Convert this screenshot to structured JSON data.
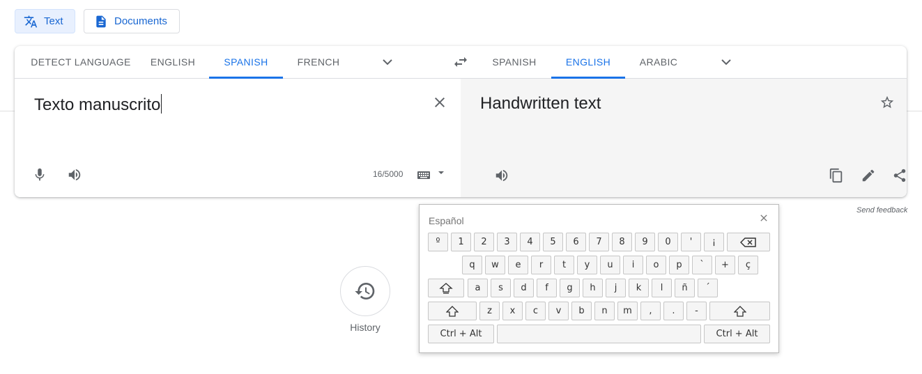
{
  "modes": {
    "text_label": "Text",
    "documents_label": "Documents"
  },
  "source_langs": [
    "DETECT LANGUAGE",
    "ENGLISH",
    "SPANISH",
    "FRENCH"
  ],
  "target_langs": [
    "SPANISH",
    "ENGLISH",
    "ARABIC"
  ],
  "source": {
    "text": "Texto manuscrito",
    "char_count": "16/5000"
  },
  "target": {
    "text": "Handwritten text"
  },
  "feedback_label": "Send feedback",
  "history_label": "History",
  "keyboard": {
    "title": "Español",
    "row1": [
      "º",
      "1",
      "2",
      "3",
      "4",
      "5",
      "6",
      "7",
      "8",
      "9",
      "0",
      "'",
      "¡"
    ],
    "row2": [
      "q",
      "w",
      "e",
      "r",
      "t",
      "y",
      "u",
      "i",
      "o",
      "p",
      "`",
      "+",
      "ç"
    ],
    "row3": [
      "a",
      "s",
      "d",
      "f",
      "g",
      "h",
      "j",
      "k",
      "l",
      "ñ",
      "´"
    ],
    "row4": [
      "z",
      "x",
      "c",
      "v",
      "b",
      "n",
      "m",
      ",",
      ".",
      "-"
    ],
    "ctrl_alt_label": "Ctrl + Alt"
  },
  "colors": {
    "accent": "#1a73e8",
    "active_mode_bg": "#e8f0fe",
    "target_pane_bg": "#f5f5f5"
  }
}
